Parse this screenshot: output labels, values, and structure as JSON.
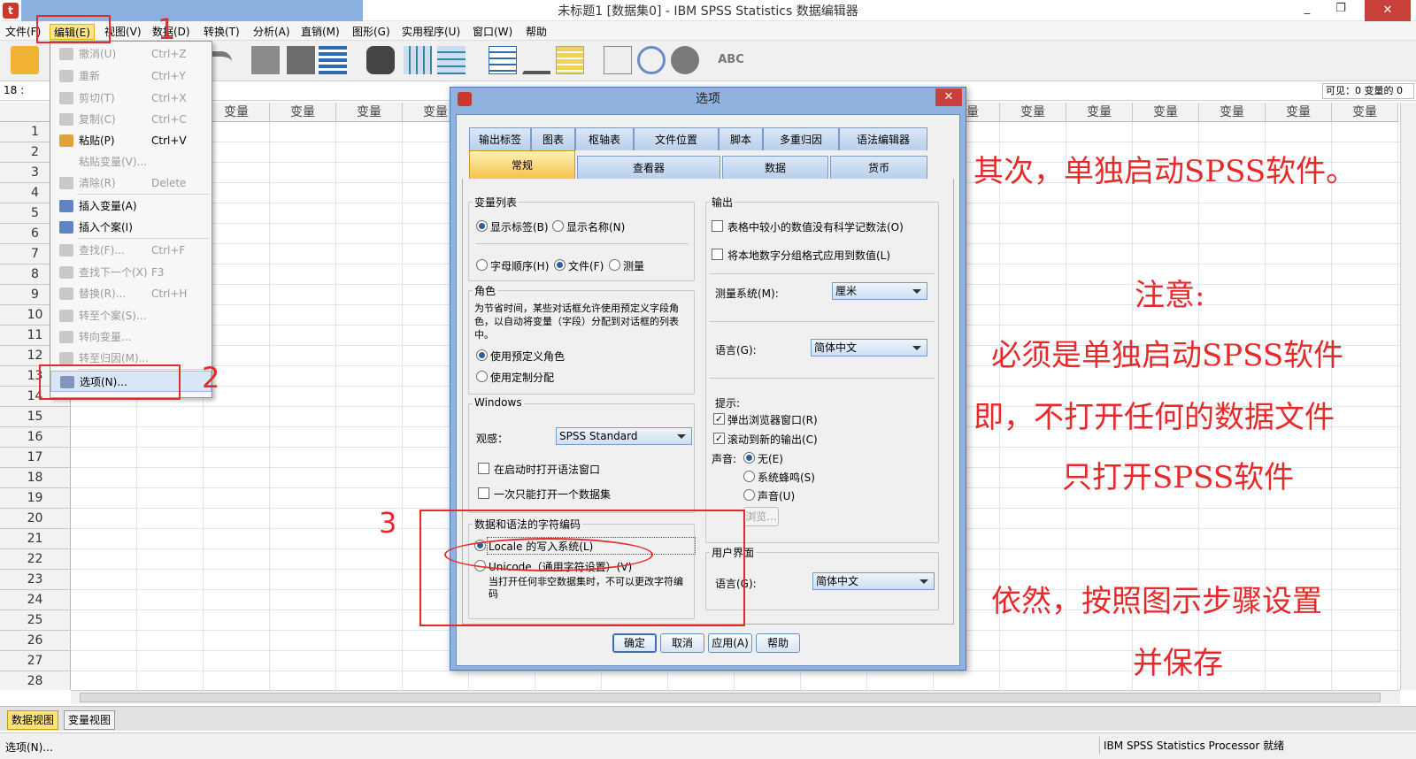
{
  "window": {
    "title": "未标题1 [数据集0] - IBM SPSS Statistics 数据编辑器",
    "restore_glyph": "❐",
    "minimize_glyph": "_",
    "close_glyph": "✕"
  },
  "menubar": [
    "文件(F)",
    "编辑(E)",
    "视图(V)",
    "数据(D)",
    "转换(T)",
    "分析(A)",
    "直销(M)",
    "图形(G)",
    "实用程序(U)",
    "窗口(W)",
    "帮助"
  ],
  "cellref": "18 :",
  "visible_info": "可见：0 变量的 0",
  "grid": {
    "column_header": "变量",
    "rows": [
      "1",
      "2",
      "3",
      "4",
      "5",
      "6",
      "7",
      "8",
      "9",
      "10",
      "11",
      "12",
      "13",
      "14",
      "15",
      "16",
      "17",
      "18",
      "19",
      "20",
      "21",
      "22",
      "23",
      "24",
      "25",
      "26",
      "27",
      "28"
    ]
  },
  "edit_menu": [
    {
      "label": "撤消(U)",
      "shortcut": "Ctrl+Z",
      "enabled": false,
      "icon": "undo-icon"
    },
    {
      "label": "重新",
      "shortcut": "Ctrl+Y",
      "enabled": false,
      "icon": "redo-icon"
    },
    {
      "label": "剪切(T)",
      "shortcut": "Ctrl+X",
      "enabled": false,
      "icon": "cut-icon"
    },
    {
      "label": "复制(C)",
      "shortcut": "Ctrl+C",
      "enabled": false,
      "icon": "copy-icon"
    },
    {
      "label": "粘贴(P)",
      "shortcut": "Ctrl+V",
      "enabled": true,
      "icon": "paste-icon"
    },
    {
      "label": "粘贴变量(V)...",
      "shortcut": "",
      "enabled": false,
      "icon": ""
    },
    {
      "label": "清除(R)",
      "shortcut": "Delete",
      "enabled": false,
      "icon": "clear-icon"
    },
    {
      "label": "插入变量(A)",
      "shortcut": "",
      "enabled": true,
      "icon": "insert-variable-icon"
    },
    {
      "label": "插入个案(I)",
      "shortcut": "",
      "enabled": true,
      "icon": "insert-case-icon"
    },
    {
      "label": "查找(F)...",
      "shortcut": "Ctrl+F",
      "enabled": false,
      "icon": "find-icon"
    },
    {
      "label": "查找下一个(X)",
      "shortcut": "F3",
      "enabled": false,
      "icon": "find-next-icon"
    },
    {
      "label": "替换(R)...",
      "shortcut": "Ctrl+H",
      "enabled": false,
      "icon": "replace-icon"
    },
    {
      "label": "转至个案(S)...",
      "shortcut": "",
      "enabled": false,
      "icon": "goto-case-icon"
    },
    {
      "label": "转向变量...",
      "shortcut": "",
      "enabled": false,
      "icon": "goto-variable-icon"
    },
    {
      "label": "转至归因(M)...",
      "shortcut": "",
      "enabled": false,
      "icon": "goto-imputation-icon"
    },
    {
      "label": "选项(N)...",
      "shortcut": "",
      "enabled": true,
      "icon": "options-icon"
    }
  ],
  "dialog": {
    "title": "选项",
    "close_glyph": "✕",
    "tabs_row1": [
      "输出标签",
      "图表",
      "枢轴表",
      "文件位置",
      "脚本",
      "多重归因",
      "语法编辑器"
    ],
    "tabs_row2": [
      "常规",
      "查看器",
      "数据",
      "货币"
    ],
    "selected_tab": "常规",
    "variable_list": {
      "label": "变量列表",
      "display": [
        "显示标签(B)",
        "显示名称(N)"
      ],
      "order": [
        "字母顺序(H)",
        "文件(F)",
        "测量"
      ]
    },
    "role": {
      "label": "角色",
      "desc": "为节省时间，某些对话框允许使用预定义字段角色，以自动将变量（字段）分配到对话框的列表中。",
      "options": [
        "使用预定义角色",
        "使用定制分配"
      ]
    },
    "windows": {
      "label": "Windows",
      "look_label": "观感：",
      "look_value": "SPSS Standard",
      "open_syntax": "在启动时打开语法窗口",
      "one_dataset": "一次只能打开一个数据集"
    },
    "encoding": {
      "label": "数据和语法的字符编码",
      "locale": "Locale 的写入系统(L)",
      "unicode": "Unicode（通用字符设置）(V)",
      "note": "当打开任何非空数据集时，不可以更改字符编码"
    },
    "output": {
      "label": "输出",
      "no_sci": "表格中较小的数值没有科学记数法(O)",
      "apply_locale": "将本地数字分组格式应用到数值(L)",
      "measure_label": "测量系统(M):",
      "measure_value": "厘米",
      "lang_label": "语言(G):",
      "lang_value": "简体中文",
      "notify_label": "提示:",
      "popup": "弹出浏览器窗口(R)",
      "scroll": "滚动到新的输出(C)",
      "sound_label": "声音:",
      "sounds": [
        "无(E)",
        "系统蜂鸣(S)",
        "声音(U)"
      ],
      "browse": "浏览..."
    },
    "ui": {
      "label": "用户界面",
      "lang_label": "语言(G):",
      "lang_value": "简体中文"
    },
    "buttons": [
      "确定",
      "取消",
      "应用(A)",
      "帮助"
    ]
  },
  "bottom_tabs": [
    "数据视图",
    "变量视图"
  ],
  "status": {
    "left": "选项(N)...",
    "right": "IBM SPSS Statistics Processor 就绪"
  },
  "annotations": {
    "num1": "1",
    "num2": "2",
    "num3": "3",
    "notes": [
      "其次，单独启动SPSS软件。",
      "注意:",
      "必须是单独启动SPSS软件",
      "即，不打开任何的数据文件",
      "只打开SPSS软件",
      "依然，按照图示步骤设置",
      "并保存"
    ],
    "color": "#e62a2a"
  },
  "colors": {
    "highlight": "#fde58a",
    "dialog_frame": "#8fb3de",
    "selected_tab": "#f6c24a"
  }
}
